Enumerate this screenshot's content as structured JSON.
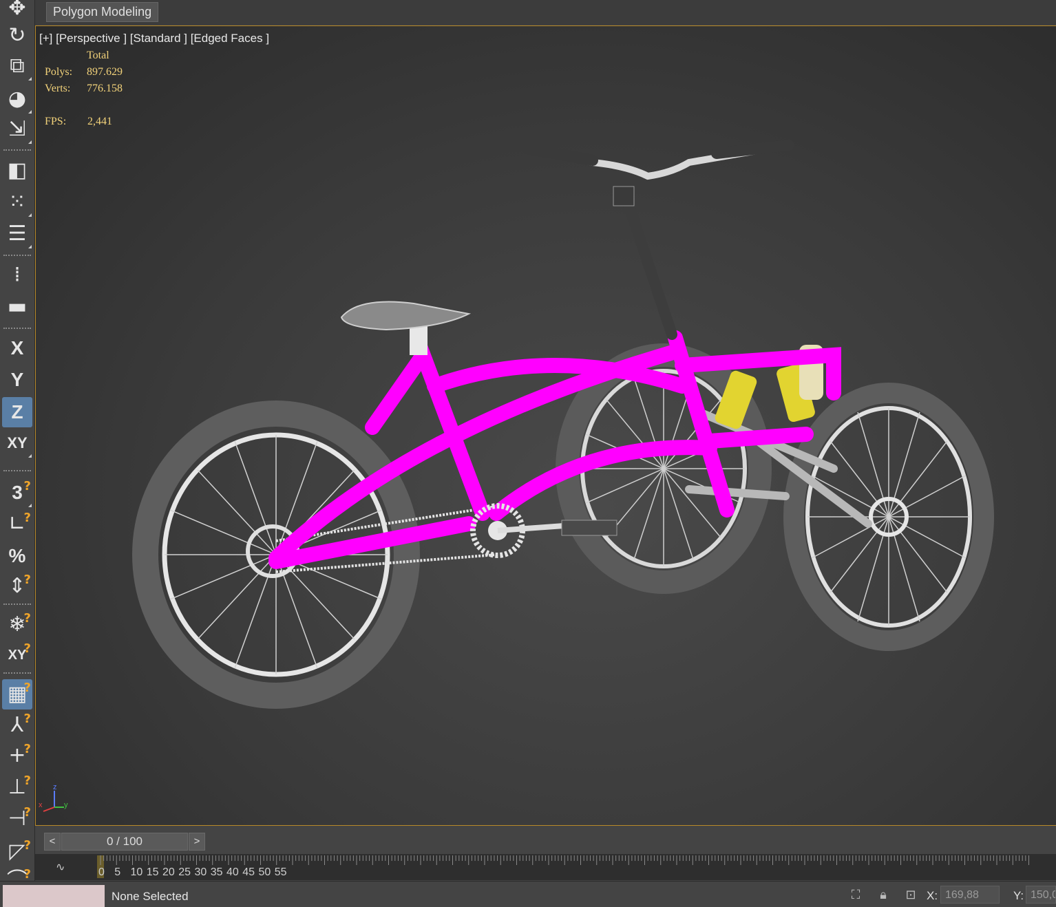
{
  "ribbon": {
    "tab_label": "Polygon Modeling"
  },
  "toolbar": {
    "tools": [
      {
        "name": "move-icon",
        "glyph": "✥"
      },
      {
        "name": "rotate-icon",
        "glyph": "↻"
      },
      {
        "name": "scale-icon",
        "glyph": "⧉"
      },
      {
        "name": "place-icon",
        "glyph": "◕"
      },
      {
        "name": "link-icon",
        "glyph": "⇲"
      },
      {
        "name": "mirror-icon",
        "glyph": "◧"
      },
      {
        "name": "array-icon",
        "glyph": "⁙"
      },
      {
        "name": "align-icon",
        "glyph": "☰"
      },
      {
        "name": "snap-grid-icon",
        "glyph": "⁞"
      },
      {
        "name": "measure-icon",
        "glyph": "▬"
      }
    ],
    "axes": {
      "x": "X",
      "y": "Y",
      "z": "Z",
      "xy": "XY"
    },
    "snaps": {
      "snap3": "3",
      "percent": "%",
      "xy_snap": "XY"
    },
    "active_axis": "Z"
  },
  "viewport": {
    "label": "[+] [Perspective ] [Standard ] [Edged Faces ]",
    "stats": {
      "total_header": "Total",
      "polys_label": "Polys:",
      "polys_value": "897.629",
      "verts_label": "Verts:",
      "verts_value": "776.158",
      "fps_label": "FPS:",
      "fps_value": "2,441"
    },
    "gizmo": {
      "z": "z",
      "x": "x",
      "y": "y"
    },
    "frame_color": "#ff00ff"
  },
  "timeline": {
    "prev": "<",
    "next": ">",
    "frame_text": "0 / 100",
    "current_frame": 0,
    "ticks": [
      "0",
      "5",
      "10",
      "15",
      "20",
      "25",
      "30",
      "35",
      "40",
      "45",
      "50",
      "55"
    ]
  },
  "status": {
    "selection": "None Selected",
    "x_label": "X:",
    "x_value": "169,88",
    "y_label": "Y:",
    "y_value": "150,0"
  }
}
